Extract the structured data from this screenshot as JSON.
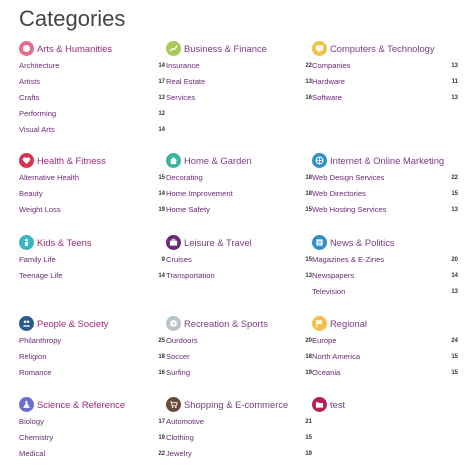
{
  "page": {
    "title": "Categories"
  },
  "categories": [
    {
      "name": "Arts & Humanities",
      "icon": "palette-icon",
      "color": "#e56b8f",
      "label_color": "#a0287a",
      "items": [
        {
          "label": "Architecture",
          "count": "14"
        },
        {
          "label": "Artists",
          "count": "17"
        },
        {
          "label": "Crafts",
          "count": "13"
        },
        {
          "label": "Performing",
          "count": "12"
        },
        {
          "label": "Visual Arts",
          "count": "14"
        }
      ]
    },
    {
      "name": "Business & Finance",
      "icon": "chart-icon",
      "color": "#a7c957",
      "label_color": "#7c3a86",
      "items": [
        {
          "label": "Insurance",
          "count": "22"
        },
        {
          "label": "Real Estate",
          "count": "13"
        },
        {
          "label": "Services",
          "count": "16"
        }
      ]
    },
    {
      "name": "Computers & Technology",
      "icon": "monitor-icon",
      "color": "#f0c24a",
      "label_color": "#7c3a86",
      "items": [
        {
          "label": "Companies",
          "count": "13"
        },
        {
          "label": "Hardware",
          "count": "11"
        },
        {
          "label": "Software",
          "count": "13"
        }
      ]
    },
    {
      "name": "Health & Fitness",
      "icon": "heart-icon",
      "color": "#d9344f",
      "label_color": "#a0287a",
      "items": [
        {
          "label": "Alternative Health",
          "count": "15"
        },
        {
          "label": "Beauty",
          "count": "14"
        },
        {
          "label": "Weight Loss",
          "count": "19"
        }
      ]
    },
    {
      "name": "Home & Garden",
      "icon": "home-icon",
      "color": "#3bb4a0",
      "label_color": "#7c3a86",
      "items": [
        {
          "label": "Decorating",
          "count": "18"
        },
        {
          "label": "Home Improvement",
          "count": "18"
        },
        {
          "label": "Home Safety",
          "count": "15"
        }
      ]
    },
    {
      "name": "Internet & Online Marketing",
      "icon": "globe-icon",
      "color": "#2f8fc9",
      "label_color": "#7c3a86",
      "items": [
        {
          "label": "Web Design Services",
          "count": "22"
        },
        {
          "label": "Web Directories",
          "count": "15"
        },
        {
          "label": "Web Hosting Services",
          "count": "13"
        }
      ]
    },
    {
      "name": "Kids & Teens",
      "icon": "child-icon",
      "color": "#3bb4c4",
      "label_color": "#a0287a",
      "items": [
        {
          "label": "Family Life",
          "count": "9"
        },
        {
          "label": "Teenage Life",
          "count": "14"
        }
      ]
    },
    {
      "name": "Leisure & Travel",
      "icon": "suitcase-icon",
      "color": "#6b2a76",
      "label_color": "#7c3a86",
      "items": [
        {
          "label": "Cruises",
          "count": "15"
        },
        {
          "label": "Transportation",
          "count": "13"
        }
      ]
    },
    {
      "name": "News & Politics",
      "icon": "newspaper-icon",
      "color": "#2f8fc9",
      "label_color": "#7c3a86",
      "items": [
        {
          "label": "Magazines & E-Zines",
          "count": "20"
        },
        {
          "label": "Newspapers",
          "count": "14"
        },
        {
          "label": "Television",
          "count": "13"
        }
      ]
    },
    {
      "name": "People & Society",
      "icon": "people-icon",
      "color": "#2a5b8c",
      "label_color": "#a0287a",
      "items": [
        {
          "label": "Philanthropy",
          "count": "25"
        },
        {
          "label": "Religion",
          "count": "18"
        },
        {
          "label": "Romance",
          "count": "16"
        }
      ]
    },
    {
      "name": "Recreation & Sports",
      "icon": "ball-icon",
      "color": "#b8c4cc",
      "label_color": "#7c3a86",
      "items": [
        {
          "label": "Ourdoors",
          "count": "20"
        },
        {
          "label": "Soccer",
          "count": "18"
        },
        {
          "label": "Surfing",
          "count": "19"
        }
      ]
    },
    {
      "name": "Regional",
      "icon": "flag-icon",
      "color": "#f0c24a",
      "label_color": "#7c3a86",
      "items": [
        {
          "label": "Europe",
          "count": "24"
        },
        {
          "label": "North America",
          "count": "15"
        },
        {
          "label": "Oceania",
          "count": "15"
        }
      ]
    },
    {
      "name": "Science & Reference",
      "icon": "flask-icon",
      "color": "#6b6fd0",
      "label_color": "#a0287a",
      "items": [
        {
          "label": "Biology",
          "count": "17"
        },
        {
          "label": "Chemistry",
          "count": "19"
        },
        {
          "label": "Medical",
          "count": "22"
        }
      ]
    },
    {
      "name": "Shopping & E-commerce",
      "icon": "cart-icon",
      "color": "#6b4a3a",
      "label_color": "#7c3a86",
      "items": [
        {
          "label": "Automotive",
          "count": "21"
        },
        {
          "label": "Clothing",
          "count": "15"
        },
        {
          "label": "Jewelry",
          "count": "19"
        }
      ]
    },
    {
      "name": "test",
      "icon": "folder-icon",
      "color": "#b5205a",
      "label_color": "#7c3a86",
      "items": []
    }
  ]
}
